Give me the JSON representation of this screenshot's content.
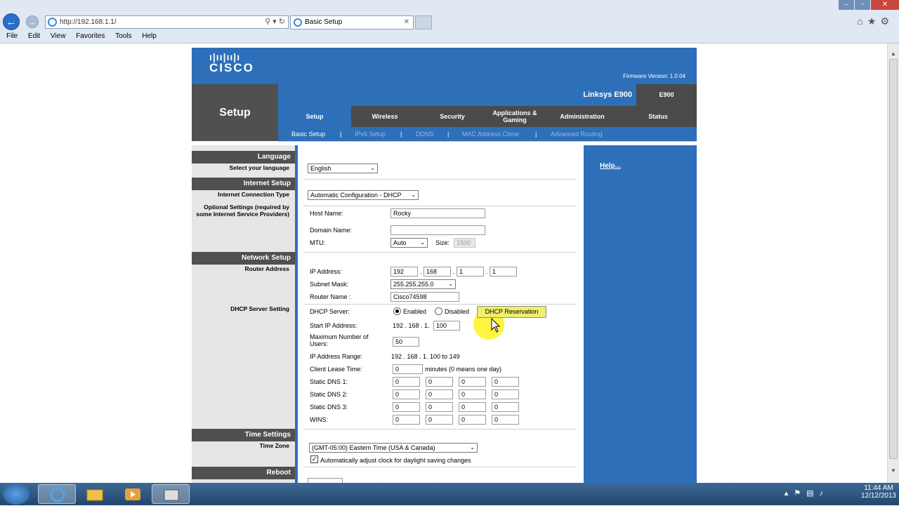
{
  "browser": {
    "url": "http://192.168.1.1/",
    "tab_title": "Basic Setup",
    "tab_close": "✕",
    "menu": [
      "File",
      "Edit",
      "View",
      "Favorites",
      "Tools",
      "Help"
    ]
  },
  "router": {
    "brand": "cisco",
    "firmware": "Firmware Version: 1.0.04",
    "section_title": "Setup",
    "product_name": "Linksys E900",
    "model": "E900",
    "tabs": [
      {
        "label": "Setup",
        "active": true
      },
      {
        "label": "Wireless",
        "active": false
      },
      {
        "label": "Security",
        "active": false
      },
      {
        "label": "Applications & Gaming",
        "active": false
      },
      {
        "label": "Administration",
        "active": false
      },
      {
        "label": "Status",
        "active": false
      }
    ],
    "subtabs": [
      "Basic Setup",
      "IPv6 Setup",
      "DDNS",
      "MAC Address Clone",
      "Advanced Routing"
    ],
    "subtab_sep": "|",
    "help_link": "Help..."
  },
  "sections": {
    "language": {
      "head": "Language",
      "label": "Select your language",
      "value": "English"
    },
    "internet": {
      "head": "Internet Setup",
      "conn_label": "Internet Connection Type",
      "conn_value": "Automatic Configuration - DHCP",
      "optional_label": "Optional Settings (required by some Internet Service Providers)",
      "host_label": "Host Name:",
      "host_value": "Rocky",
      "domain_label": "Domain Name:",
      "domain_value": "",
      "mtu_label": "MTU:",
      "mtu_value": "Auto",
      "size_label": "Size:",
      "size_value": "1500"
    },
    "network": {
      "head": "Network Setup",
      "router_label": "Router Address",
      "ip_label": "IP Address:",
      "ip": [
        "192",
        "168",
        "1",
        "1"
      ],
      "subnet_label": "Subnet Mask:",
      "subnet_value": "255.255.255.0",
      "router_name_label": "Router Name :",
      "router_name_value": "Cisco74598",
      "dhcp_section_label": "DHCP Server Setting",
      "dhcp_server_label": "DHCP Server:",
      "enabled_label": "Enabled",
      "disabled_label": "Disabled",
      "dhcp_enabled": true,
      "reservation_button": "DHCP Reservation",
      "start_ip_label": "Start IP Address:",
      "start_ip_prefix": "192 . 168 . 1.",
      "start_ip_value": "100",
      "max_users_label": "Maximum Number of Users:",
      "max_users_value": "50",
      "range_label": "IP Address Range:",
      "range_value": "192 . 168 . 1. 100 to 149",
      "lease_label": "Client Lease Time:",
      "lease_value": "0",
      "lease_unit": "minutes (0 means one day)",
      "dns1_label": "Static DNS 1:",
      "dns2_label": "Static DNS 2:",
      "dns3_label": "Static DNS 3:",
      "wins_label": "WINS:",
      "octet_value": "0"
    },
    "time": {
      "head": "Time Settings",
      "zone_label": "Time Zone",
      "zone_value": "(GMT-05:00) Eastern Time (USA & Canada)",
      "dst_label": "Automatically adjust clock for daylight saving changes",
      "dst_checked": true
    },
    "reboot": {
      "head": "Reboot"
    }
  },
  "taskbar": {
    "time": "11:44 AM",
    "date": "12/12/2013"
  }
}
